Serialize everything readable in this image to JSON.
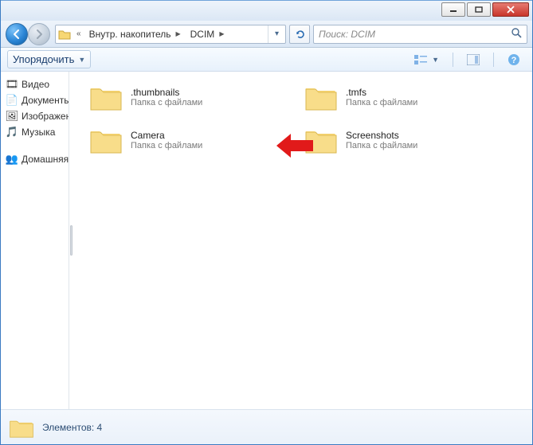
{
  "breadcrumb": {
    "seg1": "Внутр. накопитель",
    "seg2": "DCIM"
  },
  "search": {
    "placeholder": "Поиск: DCIM"
  },
  "toolbar": {
    "organize": "Упорядочить"
  },
  "sidebar": {
    "items": [
      {
        "icon": "video-icon",
        "glyph": "🎞",
        "label": "Видео"
      },
      {
        "icon": "document-icon",
        "glyph": "📄",
        "label": "Документы"
      },
      {
        "icon": "pictures-icon",
        "glyph": "🖼",
        "label": "Изображения"
      },
      {
        "icon": "music-icon",
        "glyph": "🎵",
        "label": "Музыка"
      }
    ],
    "group": {
      "icon": "homegroup-icon",
      "glyph": "👥",
      "label": "Домашняя группа"
    }
  },
  "folders": {
    "desc": "Папка с файлами",
    "items": [
      {
        "name": ".thumbnails"
      },
      {
        "name": ".tmfs"
      },
      {
        "name": "Camera"
      },
      {
        "name": "Screenshots"
      }
    ]
  },
  "status": {
    "text": "Элементов: 4"
  }
}
